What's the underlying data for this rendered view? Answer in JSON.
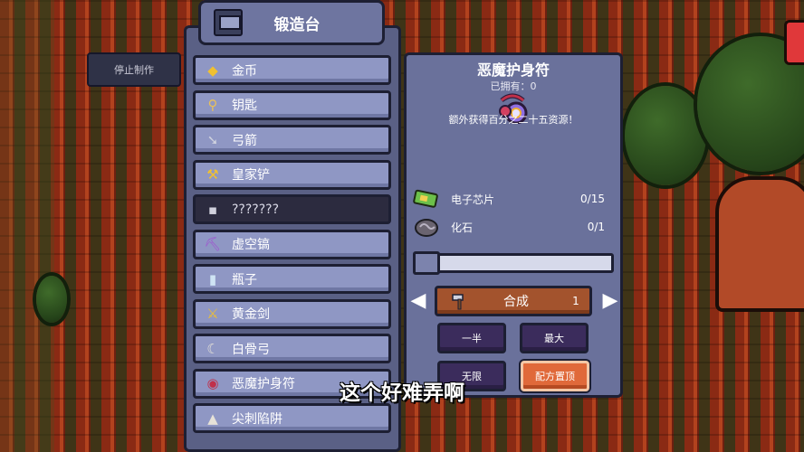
{
  "hud": {
    "stop_label": "停止制作"
  },
  "forge": {
    "title": "锻造台",
    "recipes": [
      {
        "label": "金币",
        "icon": "gold-coin-icon",
        "selected": false
      },
      {
        "label": "钥匙",
        "icon": "key-icon",
        "selected": false
      },
      {
        "label": "弓箭",
        "icon": "arrow-icon",
        "selected": false
      },
      {
        "label": "皇家铲",
        "icon": "royal-shovel-icon",
        "selected": false
      },
      {
        "label": "???????",
        "icon": "locked-icon",
        "selected": true
      },
      {
        "label": "虚空镐",
        "icon": "void-pickaxe-icon",
        "selected": false
      },
      {
        "label": "瓶子",
        "icon": "bottle-icon",
        "selected": false
      },
      {
        "label": "黄金剑",
        "icon": "gold-sword-icon",
        "selected": false
      },
      {
        "label": "白骨弓",
        "icon": "bone-bow-icon",
        "selected": false
      },
      {
        "label": "恶魔护身符",
        "icon": "demon-amulet-icon",
        "selected": false
      },
      {
        "label": "尖刺陷阱",
        "icon": "spike-trap-icon",
        "selected": false
      }
    ]
  },
  "detail": {
    "name": "恶魔护身符",
    "owned": "已拥有：0",
    "description": "额外获得百分之二十五资源！",
    "materials": [
      {
        "name": "电子芯片",
        "count": "0/15",
        "icon": "circuit-chip-icon"
      },
      {
        "name": "化石",
        "count": "0/1",
        "icon": "fossil-icon"
      }
    ],
    "slider_value": 0,
    "craft_label": "合成",
    "craft_qty": "1",
    "buttons": {
      "half": "一半",
      "max": "最大",
      "unlimited": "无限",
      "recipe": "配方置顶"
    }
  },
  "subtitle": "这个好难弄啊",
  "colors": {
    "panel": "#5a6085",
    "button": "#8f97c4",
    "craft": "#a3532d",
    "highlight": "#e0693a"
  }
}
